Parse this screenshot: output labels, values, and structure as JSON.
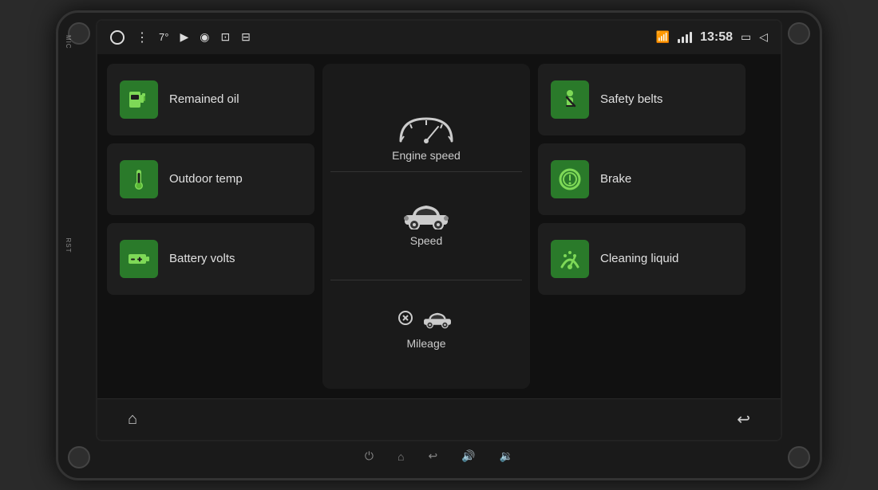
{
  "device": {
    "mic_label": "MIC",
    "rst_label": "RST"
  },
  "status_bar": {
    "temperature": "7°",
    "time": "13:58",
    "bluetooth_icon": "bluetooth",
    "wifi_icon": "wifi",
    "window_icon": "▭",
    "back_icon": "◁"
  },
  "tiles": {
    "remained_oil": {
      "label": "Remained oil",
      "icon": "fuel"
    },
    "outdoor_temp": {
      "label": "Outdoor temp",
      "icon": "thermometer"
    },
    "battery_volts": {
      "label": "Battery volts",
      "icon": "battery"
    },
    "engine_speed": {
      "label": "Engine speed",
      "icon": "gauge"
    },
    "speed": {
      "label": "Speed",
      "icon": "car"
    },
    "mileage": {
      "label": "Mileage",
      "icon": "car-warning"
    },
    "safety_belts": {
      "label": "Safety belts",
      "icon": "seatbelt"
    },
    "brake": {
      "label": "Brake",
      "icon": "brake"
    },
    "cleaning_liquid": {
      "label": "Cleaning liquid",
      "icon": "wiper"
    }
  },
  "nav": {
    "home_icon": "⌂",
    "back_icon": "↩"
  },
  "bottom_icons": [
    "⏻",
    "⌂",
    "↩",
    "🔊",
    "🔉"
  ]
}
